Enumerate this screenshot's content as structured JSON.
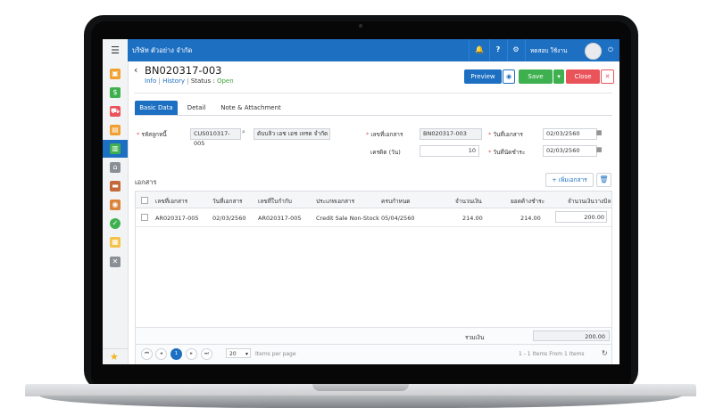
{
  "header": {
    "company": "บริษัท ตัวอย่าง จำกัด",
    "username": "ทดสอบ ใช้งาน"
  },
  "document": {
    "number": "BN020317-003",
    "links": [
      "Info",
      "History"
    ],
    "status_label": "Status :",
    "status_value": "Open"
  },
  "toolbar": {
    "preview": "Preview",
    "save": "Save",
    "close": "Close"
  },
  "tabs": [
    "Basic Data",
    "Detail",
    "Note & Attachment"
  ],
  "form": {
    "customer_code_label": "รหัสลูกหนี้",
    "customer_code": "CUS010317-005",
    "customer_name": "ดับบลิว เอช เอช เทรด จำกัด",
    "doc_no_label": "เลขที่เอกสาร",
    "doc_no": "BN020317-003",
    "doc_date_label": "วันที่เอกสาร",
    "doc_date": "02/03/2560",
    "credit_label": "เครดิต (วัน)",
    "credit_days": "10",
    "due_date_label": "วันที่นัดชำระ",
    "due_date": "02/03/2560"
  },
  "documents": {
    "title": "เอกสาร",
    "add_button": "+ เพิ่มเอกสาร",
    "columns": [
      "เลขที่เอกสาร",
      "วันที่เอกสาร",
      "เลขที่ใบกำกับ",
      "ประเภทเอกสาร",
      "ครบกำหนด",
      "จำนวนเงิน",
      "ยอดค้างชำระ",
      "จำนวนเงินวางบิล"
    ],
    "rows": [
      {
        "doc_no": "AR020317-005",
        "doc_date": "02/03/2560",
        "invoice_no": "AR020317-005",
        "type": "Credit Sale Non-Stock",
        "due": "05/04/2560",
        "amount": "214.00",
        "outstanding": "214.00",
        "billing_amount": "200.00"
      }
    ],
    "total_label": "รวมเงิน",
    "total": "200.00"
  },
  "pager": {
    "current_page": "1",
    "page_size": "20",
    "items_per_page": "Items per page",
    "summary": "1 - 1 Items From 1 Items"
  }
}
